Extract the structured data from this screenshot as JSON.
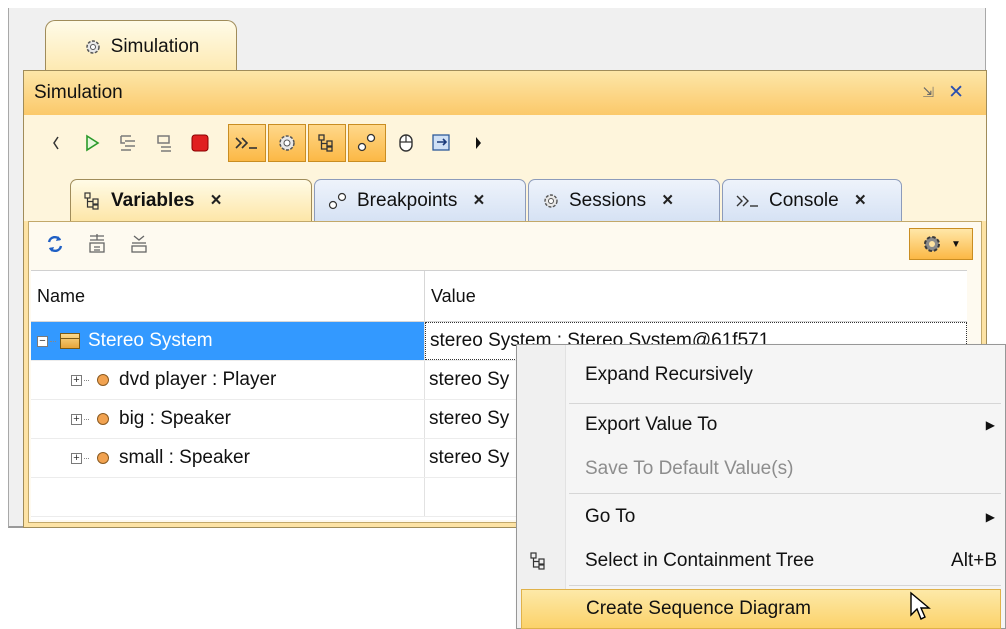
{
  "window": {
    "outer_tab_label": "Simulation",
    "panel_title": "Simulation"
  },
  "inner_tabs": [
    {
      "label": "Variables",
      "close": "×"
    },
    {
      "label": "Breakpoints",
      "close": "×"
    },
    {
      "label": "Sessions",
      "close": "×"
    },
    {
      "label": "Console",
      "close": "×"
    }
  ],
  "table": {
    "headers": {
      "name": "Name",
      "value": "Value"
    },
    "rows": [
      {
        "name": "Stereo System",
        "value": "stereo System : Stereo System@61f571"
      },
      {
        "name": "dvd player : Player",
        "value": "stereo Sy"
      },
      {
        "name": "big : Speaker",
        "value": "stereo Sy"
      },
      {
        "name": "small : Speaker",
        "value": "stereo Sy"
      }
    ]
  },
  "context_menu": {
    "items": [
      {
        "label": "Expand Recursively"
      },
      {
        "label": "Export Value To",
        "submenu": true
      },
      {
        "label": "Save To Default Value(s)",
        "disabled": true
      },
      {
        "label": "Go To",
        "submenu": true
      },
      {
        "label": "Select in Containment Tree",
        "shortcut": "Alt+B"
      },
      {
        "label": "Create Sequence Diagram",
        "highlighted": true
      }
    ]
  },
  "colors": {
    "panel_header": "#fbc96a",
    "selection": "#3399ff",
    "menu_highlight": "#fbd26a",
    "stop_red": "#e02020"
  }
}
